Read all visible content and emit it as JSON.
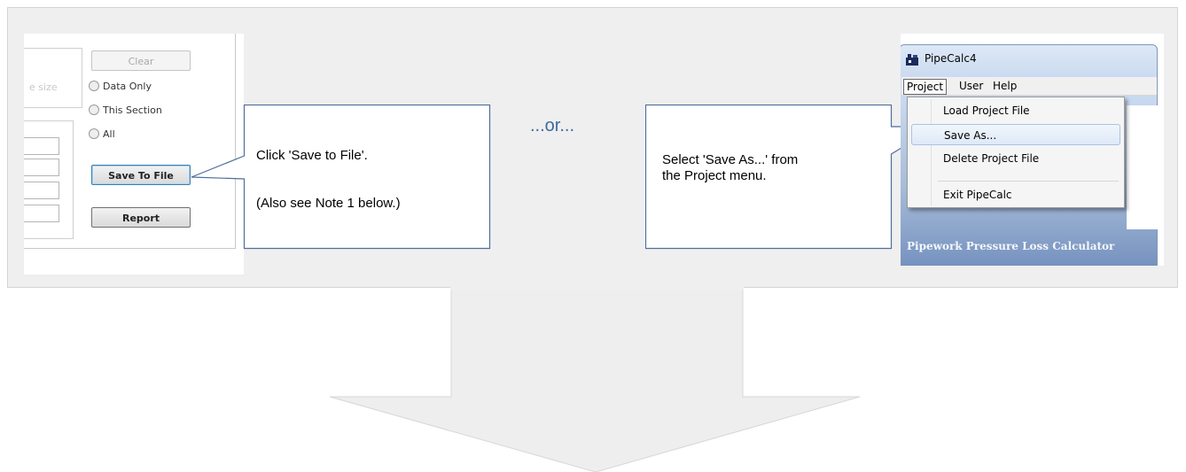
{
  "ellipsis_or": "...or...",
  "left_screenshot": {
    "partial_label": "e size",
    "clear_button": "Clear",
    "radio_data_only": "Data Only",
    "radio_this_section": "This Section",
    "radio_all": "All",
    "save_to_file_button": "Save To File",
    "report_button": "Report"
  },
  "callout_left": {
    "line1": "Click 'Save to File'.",
    "line2": "(Also see Note 1 below.)"
  },
  "callout_right": {
    "line1": "Select 'Save As...' from",
    "line2": "the Project menu."
  },
  "right_screenshot": {
    "app_title": "PipeCalc4",
    "menus": [
      "Project",
      "User",
      "Help"
    ],
    "dropdown_items": [
      "Load Project File",
      "Save As...",
      "Delete Project File",
      "Exit PipeCalc"
    ],
    "highlighted_item": "Save As...",
    "footer": "Pipework Pressure Loss Calculator"
  },
  "colors": {
    "or_text": "#3d6ba3",
    "callout_border": "#4f6f9a",
    "panel_bg": "#efefef",
    "arrow_fill": "#eeeeee"
  }
}
